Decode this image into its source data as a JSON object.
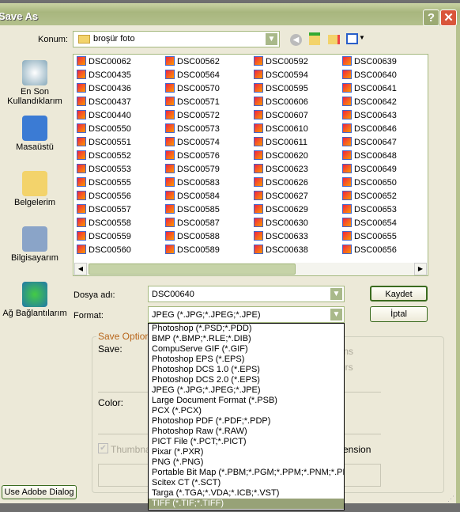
{
  "window": {
    "title": "Save As",
    "help": "?",
    "close": "✕"
  },
  "location": {
    "label": "Konum:",
    "value": "broşür foto"
  },
  "sidebar": [
    {
      "label": "En Son Kullandıklarım",
      "icon": "recent-icon"
    },
    {
      "label": "Masaüstü",
      "icon": "desktop-icon"
    },
    {
      "label": "Belgelerim",
      "icon": "documents-folder-icon"
    },
    {
      "label": "Bilgisayarım",
      "icon": "computer-icon"
    },
    {
      "label": "Ağ Bağlantılarım",
      "icon": "network-icon"
    }
  ],
  "files": [
    [
      "DSC00062",
      "DSC00435",
      "DSC00436",
      "DSC00437",
      "DSC00440",
      "DSC00550",
      "DSC00551",
      "DSC00552",
      "DSC00553",
      "DSC00555",
      "DSC00556",
      "DSC00557",
      "DSC00558",
      "DSC00559",
      "DSC00560"
    ],
    [
      "DSC00562",
      "DSC00564",
      "DSC00570",
      "DSC00571",
      "DSC00572",
      "DSC00573",
      "DSC00574",
      "DSC00576",
      "DSC00579",
      "DSC00583",
      "DSC00584",
      "DSC00585",
      "DSC00587",
      "DSC00588",
      "DSC00589"
    ],
    [
      "DSC00592",
      "DSC00594",
      "DSC00595",
      "DSC00606",
      "DSC00607",
      "DSC00610",
      "DSC00611",
      "DSC00620",
      "DSC00623",
      "DSC00626",
      "DSC00627",
      "DSC00629",
      "DSC00630",
      "DSC00633",
      "DSC00638"
    ],
    [
      "DSC00639",
      "DSC00640",
      "DSC00641",
      "DSC00642",
      "DSC00643",
      "DSC00646",
      "DSC00647",
      "DSC00648",
      "DSC00649",
      "DSC00650",
      "DSC00652",
      "DSC00653",
      "DSC00654",
      "DSC00655",
      "DSC00656"
    ]
  ],
  "filename": {
    "label": "Dosya adı:",
    "value": "DSC00640"
  },
  "format": {
    "label": "Format:",
    "value": "JPEG (*.JPG;*.JPEG;*.JPE)",
    "options": [
      "Photoshop (*.PSD;*.PDD)",
      "BMP (*.BMP;*.RLE;*.DIB)",
      "CompuServe GIF (*.GIF)",
      "Photoshop EPS (*.EPS)",
      "Photoshop DCS 1.0 (*.EPS)",
      "Photoshop DCS 2.0 (*.EPS)",
      "JPEG (*.JPG;*.JPEG;*.JPE)",
      "Large Document Format (*.PSB)",
      "PCX (*.PCX)",
      "Photoshop PDF (*.PDF;*.PDP)",
      "Photoshop Raw (*.RAW)",
      "PICT File (*.PCT;*.PICT)",
      "Pixar (*.PXR)",
      "PNG (*.PNG)",
      "Portable Bit Map (*.PBM;*.PGM;*.PPM;*.PNM;*.PFM)",
      "Scitex CT (*.SCT)",
      "Targa (*.TGA;*.VDA;*.ICB;*.VST)",
      "TIFF (*.TIF;*.TIFF)"
    ],
    "selected_index": 17
  },
  "buttons": {
    "save": "Kaydet",
    "cancel": "İptal",
    "adobe": "Use Adobe Dialog"
  },
  "options": {
    "group": "Save Options",
    "save": "Save:",
    "partial1": "ions",
    "partial2": "ors",
    "color": "Color:",
    "thumbnail": "Thumbna",
    "partial3": "ension"
  }
}
